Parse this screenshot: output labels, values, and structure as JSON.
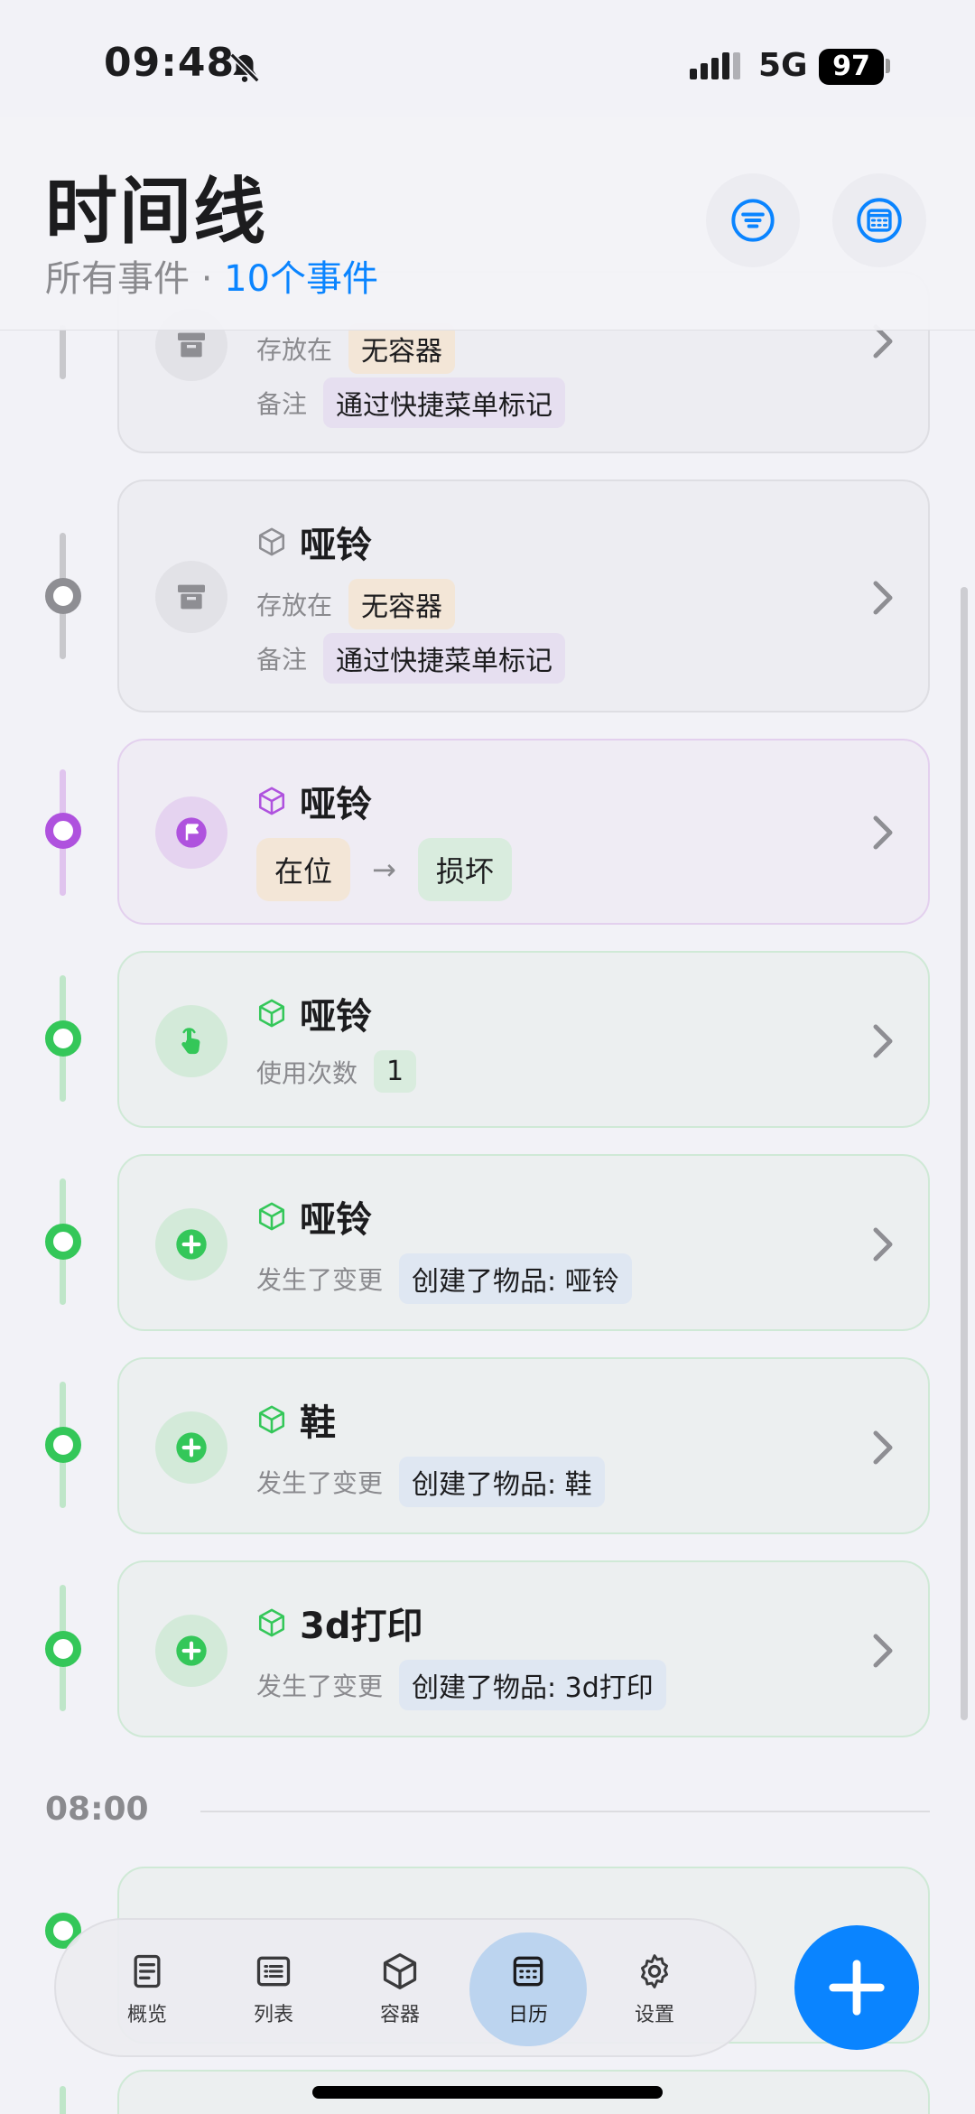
{
  "status_bar": {
    "time": "09:48",
    "network": "5G",
    "battery": "97"
  },
  "header": {
    "title": "时间线",
    "filter_label": "所有事件",
    "separator": "·",
    "count_label": "10个事件"
  },
  "cards": [
    {
      "title": "",
      "rows": [
        {
          "label": "存放在",
          "value": "无容器"
        },
        {
          "label": "备注",
          "value": "通过快捷菜单标记"
        }
      ]
    },
    {
      "title": "哑铃",
      "rows": [
        {
          "label": "存放在",
          "value": "无容器"
        },
        {
          "label": "备注",
          "value": "通过快捷菜单标记"
        }
      ]
    },
    {
      "title": "哑铃",
      "status_from": "在位",
      "status_to": "损坏"
    },
    {
      "title": "哑铃",
      "rows": [
        {
          "label": "使用次数",
          "value": "1"
        }
      ]
    },
    {
      "title": "哑铃",
      "rows": [
        {
          "label": "发生了变更",
          "value": "创建了物品: 哑铃"
        }
      ]
    },
    {
      "title": "鞋",
      "rows": [
        {
          "label": "发生了变更",
          "value": "创建了物品: 鞋"
        }
      ]
    },
    {
      "title": "3d打印",
      "rows": [
        {
          "label": "发生了变更",
          "value": "创建了物品: 3d打印"
        }
      ]
    }
  ],
  "section": {
    "time": "08:00"
  },
  "tabs": [
    {
      "label": "概览",
      "icon": "overview-icon"
    },
    {
      "label": "列表",
      "icon": "list-icon"
    },
    {
      "label": "容器",
      "icon": "cube-icon"
    },
    {
      "label": "日历",
      "icon": "calendar-icon",
      "active": true
    },
    {
      "label": "设置",
      "icon": "gear-icon"
    }
  ],
  "colors": {
    "accent": "#0a84ff",
    "gray": "#8e8e93",
    "purple": "#af52de",
    "green": "#34c759"
  }
}
